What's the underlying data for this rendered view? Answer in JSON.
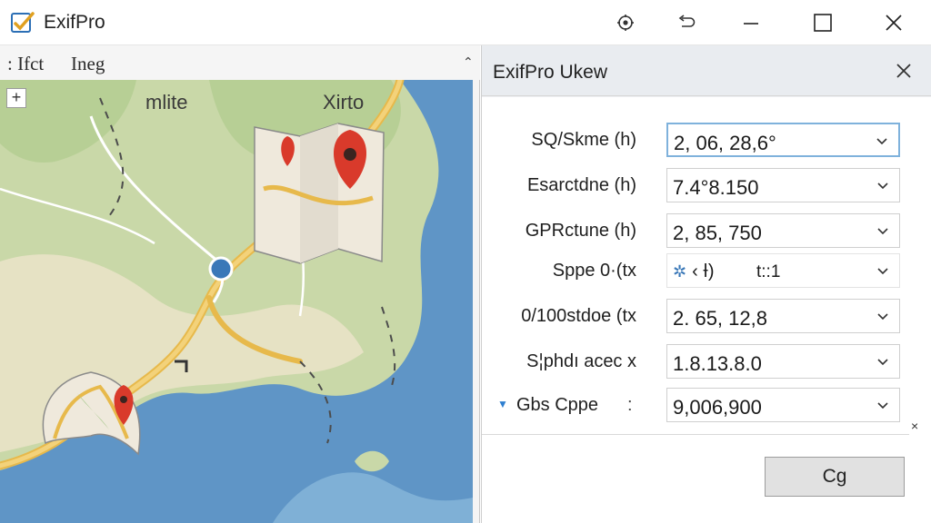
{
  "window": {
    "title": "ExifPro",
    "buttons": [
      "settings-icon",
      "undo-icon",
      "minimize-icon",
      "maximize-icon",
      "close-icon"
    ]
  },
  "left_pane": {
    "menu": [
      ": Ifct",
      "Ineg"
    ],
    "pin_glyph": "⌃",
    "map": {
      "zoom_button": "+",
      "labels": [
        "mlite",
        "Xirto"
      ]
    }
  },
  "dialog": {
    "title": "ExifPro Ukew",
    "close_icon": "×",
    "fields": [
      {
        "label": "SQ/Skme (h)",
        "value": "2, 06, 28,6°"
      },
      {
        "label": "Esarctdne (h)",
        "value": "7.4°8.150"
      },
      {
        "label": "GPRctune (h)",
        "value": "2, 85, 750"
      },
      {
        "label": "Sppe 0·(tx",
        "value_left": "‹ Ɨ)",
        "value_right": "t::1"
      },
      {
        "label": "0/100stdoe (tx",
        "value": "2. 65, 12,8"
      },
      {
        "label": "S¦phdı acec x",
        "value": "1.8.13.8.0"
      },
      {
        "label": "Gbs Cppe",
        "colon": ":",
        "value": "9,006,900"
      }
    ],
    "side_x": "×",
    "ok_button": "Cg"
  },
  "colors": {
    "accent": "#2f7fd0",
    "focus_border": "#7fb2dc",
    "map_water": "#5f95c6",
    "map_land": "#c9d8a8",
    "map_road": "#e7b94b",
    "pin_red": "#d93a2b"
  }
}
